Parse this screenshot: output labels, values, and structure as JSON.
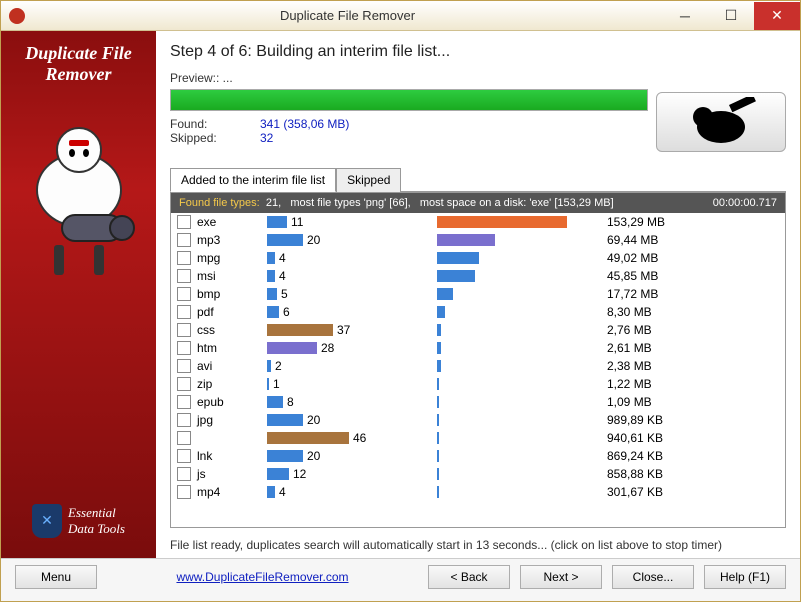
{
  "window": {
    "title": "Duplicate File Remover"
  },
  "sidebar": {
    "logo_line1": "Duplicate File",
    "logo_line2": "Remover",
    "essential_line1": "Essential",
    "essential_line2": "Data Tools"
  },
  "main": {
    "step_title": "Step 4 of 6: Building an interim file list...",
    "preview_label": "Preview:: ...",
    "progress_percent": 100,
    "found_label": "Found:",
    "found_value": "341 (358,06 MB)",
    "skipped_label": "Skipped:",
    "skipped_value": "32"
  },
  "tabs": {
    "added": "Added to the interim file list",
    "skipped": "Skipped"
  },
  "list_header": {
    "found_label": "Found file types:",
    "found_count": "21,",
    "most_types": "most file types 'png' [66],",
    "most_space": "most space on a disk: 'exe' [153,29 MB]",
    "elapsed": "00:00:00.717"
  },
  "rows": [
    {
      "ext": "exe",
      "count": 11,
      "countBarW": 20,
      "countBarColor": "#3b82d6",
      "size": "153,29 MB",
      "sizeBarW": 130,
      "sizeBarColor": "#e86a2f"
    },
    {
      "ext": "mp3",
      "count": 20,
      "countBarW": 36,
      "countBarColor": "#3b82d6",
      "size": "69,44 MB",
      "sizeBarW": 58,
      "sizeBarColor": "#7a6fce"
    },
    {
      "ext": "mpg",
      "count": 4,
      "countBarW": 8,
      "countBarColor": "#3b82d6",
      "size": "49,02 MB",
      "sizeBarW": 42,
      "sizeBarColor": "#3b82d6"
    },
    {
      "ext": "msi",
      "count": 4,
      "countBarW": 8,
      "countBarColor": "#3b82d6",
      "size": "45,85 MB",
      "sizeBarW": 38,
      "sizeBarColor": "#3b82d6"
    },
    {
      "ext": "bmp",
      "count": 5,
      "countBarW": 10,
      "countBarColor": "#3b82d6",
      "size": "17,72 MB",
      "sizeBarW": 16,
      "sizeBarColor": "#3b82d6"
    },
    {
      "ext": "pdf",
      "count": 6,
      "countBarW": 12,
      "countBarColor": "#3b82d6",
      "size": "8,30 MB",
      "sizeBarW": 8,
      "sizeBarColor": "#3b82d6"
    },
    {
      "ext": "css",
      "count": 37,
      "countBarW": 66,
      "countBarColor": "#a8743d",
      "size": "2,76 MB",
      "sizeBarW": 4,
      "sizeBarColor": "#3b82d6"
    },
    {
      "ext": "htm",
      "count": 28,
      "countBarW": 50,
      "countBarColor": "#7a6fce",
      "size": "2,61 MB",
      "sizeBarW": 4,
      "sizeBarColor": "#3b82d6"
    },
    {
      "ext": "avi",
      "count": 2,
      "countBarW": 4,
      "countBarColor": "#3b82d6",
      "size": "2,38 MB",
      "sizeBarW": 4,
      "sizeBarColor": "#3b82d6"
    },
    {
      "ext": "zip",
      "count": 1,
      "countBarW": 2,
      "countBarColor": "#3b82d6",
      "size": "1,22 MB",
      "sizeBarW": 2,
      "sizeBarColor": "#3b82d6"
    },
    {
      "ext": "epub",
      "count": 8,
      "countBarW": 16,
      "countBarColor": "#3b82d6",
      "size": "1,09 MB",
      "sizeBarW": 2,
      "sizeBarColor": "#3b82d6"
    },
    {
      "ext": "jpg",
      "count": 20,
      "countBarW": 36,
      "countBarColor": "#3b82d6",
      "size": "989,89 KB",
      "sizeBarW": 2,
      "sizeBarColor": "#3b82d6"
    },
    {
      "ext": "",
      "count": 46,
      "countBarW": 82,
      "countBarColor": "#a8743d",
      "size": "940,61 KB",
      "sizeBarW": 2,
      "sizeBarColor": "#3b82d6"
    },
    {
      "ext": "lnk",
      "count": 20,
      "countBarW": 36,
      "countBarColor": "#3b82d6",
      "size": "869,24 KB",
      "sizeBarW": 2,
      "sizeBarColor": "#3b82d6"
    },
    {
      "ext": "js",
      "count": 12,
      "countBarW": 22,
      "countBarColor": "#3b82d6",
      "size": "858,88 KB",
      "sizeBarW": 2,
      "sizeBarColor": "#3b82d6"
    },
    {
      "ext": "mp4",
      "count": 4,
      "countBarW": 8,
      "countBarColor": "#3b82d6",
      "size": "301,67 KB",
      "sizeBarW": 2,
      "sizeBarColor": "#3b82d6"
    }
  ],
  "footer_note": "File list ready, duplicates search will automatically start in 13 seconds... (click on list above to stop timer)",
  "buttons": {
    "menu": "Menu",
    "link": "www.DuplicateFileRemover.com",
    "back": "< Back",
    "next": "Next >",
    "close": "Close...",
    "help": "Help (F1)"
  }
}
